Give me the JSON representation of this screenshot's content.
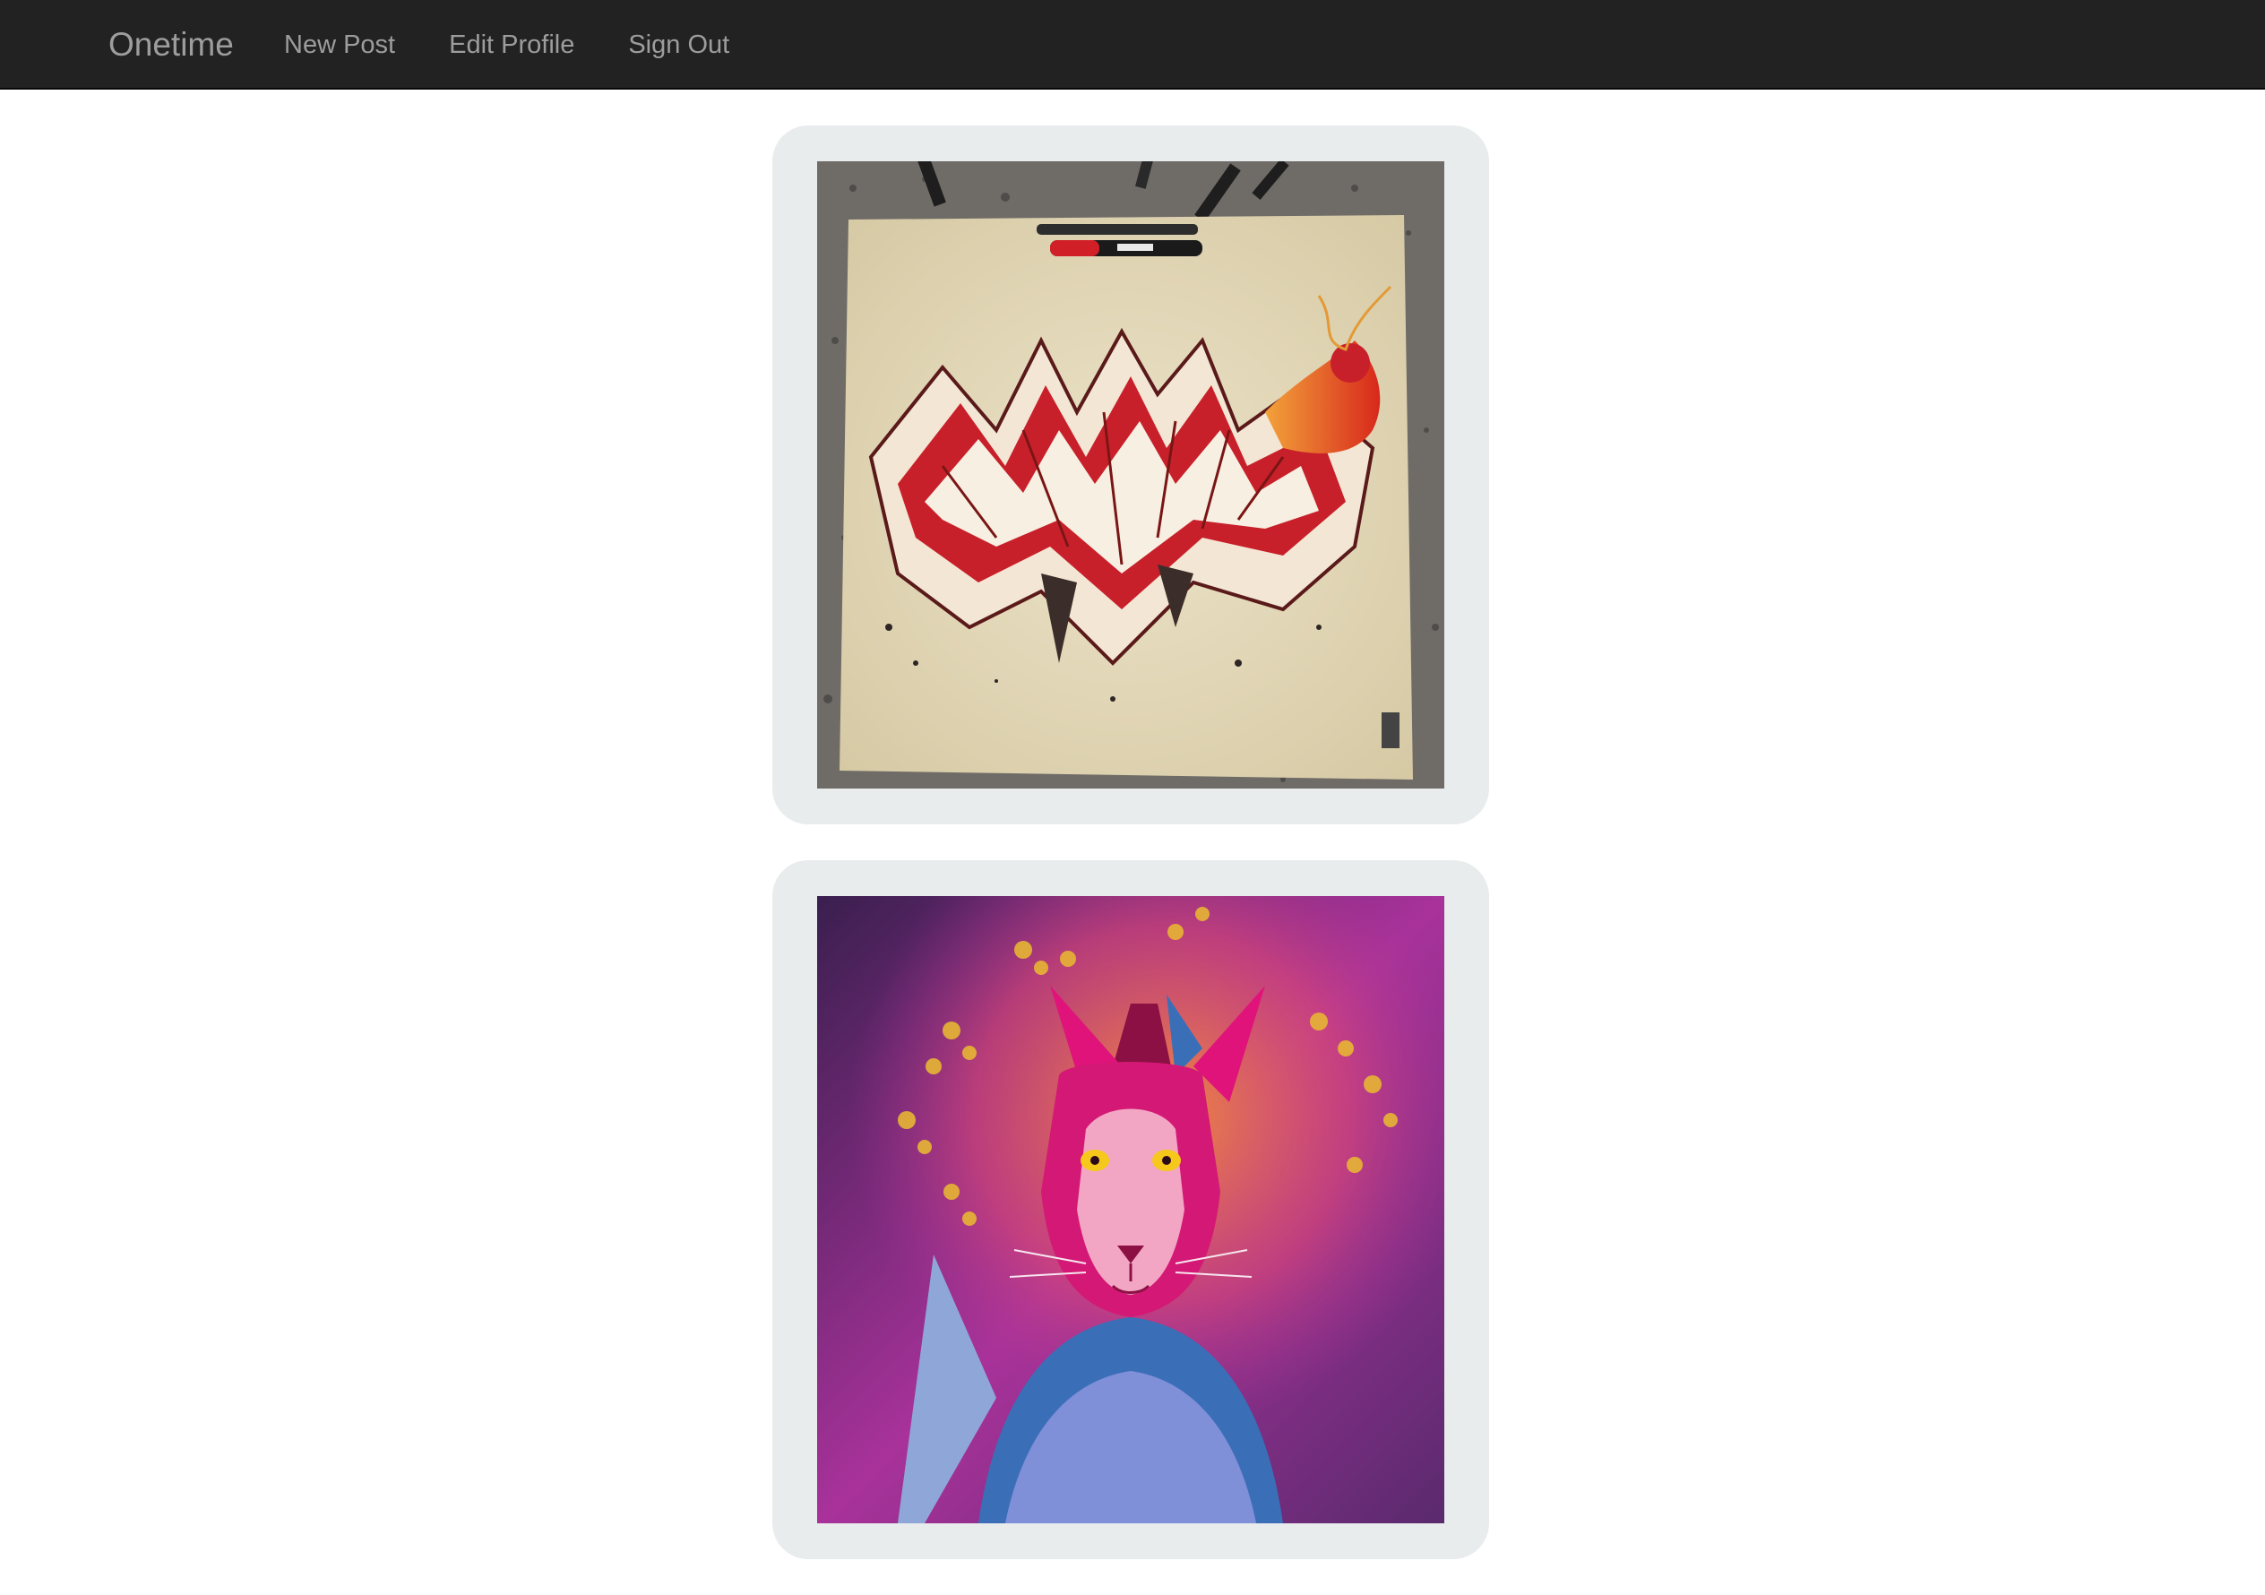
{
  "navbar": {
    "brand": "Onetime",
    "links": [
      {
        "label": "New Post"
      },
      {
        "label": "Edit Profile"
      },
      {
        "label": "Sign Out"
      }
    ]
  },
  "feed": {
    "posts": [
      {
        "image_subject": "graffiti-lettering-sketch-with-markers",
        "accent": "#c8202a"
      },
      {
        "image_subject": "psychedelic-lion-fractal-illustration",
        "accent": "#a83a9a"
      }
    ]
  },
  "colors": {
    "navbar_bg": "#222222",
    "nav_text": "#9d9d9d",
    "card_bg": "#e9eced",
    "page_bg": "#ffffff"
  }
}
